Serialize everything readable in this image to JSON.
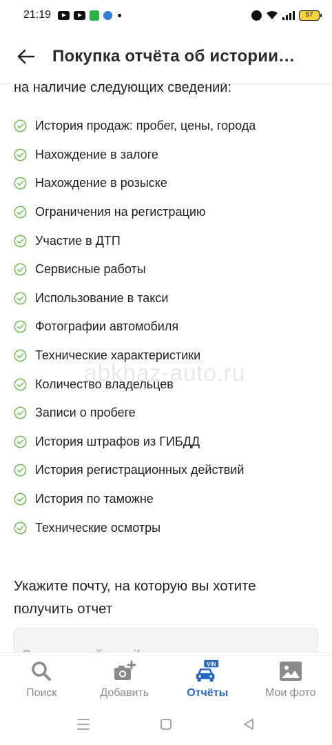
{
  "status_bar": {
    "time": "21:19",
    "battery": "57"
  },
  "header": {
    "title": "Покупка отчёта об истории…"
  },
  "content": {
    "intro": "на наличие следующих сведений:",
    "features": [
      "История продаж: пробег, цены, города",
      "Нахождение в залоге",
      "Нахождение в розыске",
      "Ограничения на регистрацию",
      "Участие в ДТП",
      "Сервисные работы",
      "Использование в такси",
      "Фотографии автомобиля",
      "Технические характеристики",
      "Количество владельцев",
      "Записи о пробеге",
      "История штрафов из ГИБДД",
      "История регистрационных действий",
      "История по таможне",
      "Технические осмотры"
    ],
    "watermark": "abkhaz-auto.ru",
    "email_prompt": "Укажите почту, на которую вы хотите получить отчет",
    "email_placeholder": "Введите свой e-mail",
    "email_value": ""
  },
  "bottom_nav": {
    "items": [
      {
        "label": "Поиск",
        "icon": "search-icon",
        "active": false
      },
      {
        "label": "Добавить",
        "icon": "add-photo-icon",
        "active": false
      },
      {
        "label": "Отчёты",
        "icon": "vin-car-icon",
        "badge": "VIN",
        "active": true
      },
      {
        "label": "Мои фото",
        "icon": "image-icon",
        "active": false
      }
    ]
  },
  "colors": {
    "accent": "#2367c8",
    "check": "#6cbf4a",
    "inactive": "#8a8a8a"
  }
}
